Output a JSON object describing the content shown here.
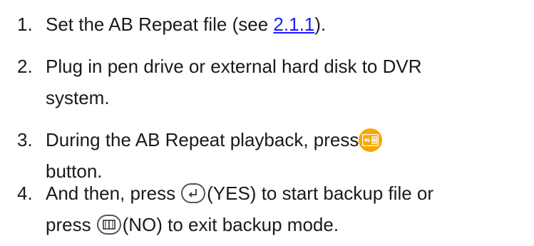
{
  "steps": [
    {
      "number": "1.",
      "text_before": "Set the AB Repeat file (see ",
      "link": "2.1.1",
      "text_after": ")."
    },
    {
      "number": "2.",
      "line1": "Plug in pen drive or external hard disk to DVR",
      "line2": "system."
    },
    {
      "number": "3.",
      "line1": "During the AB Repeat playback, press",
      "line2": "button.",
      "icon": "usb-backup-icon"
    },
    {
      "number": "4.",
      "line1_before": "And then, press",
      "yes": "(YES)",
      "line1_after": " to start backup file or",
      "line2_before": "press",
      "no": "(NO)",
      "line2_after": " to exit backup mode.",
      "icons": [
        "enter-icon",
        "menu-book-icon"
      ]
    }
  ],
  "colors": {
    "link": "#1a1aff",
    "usb_button": "#f6a800"
  }
}
